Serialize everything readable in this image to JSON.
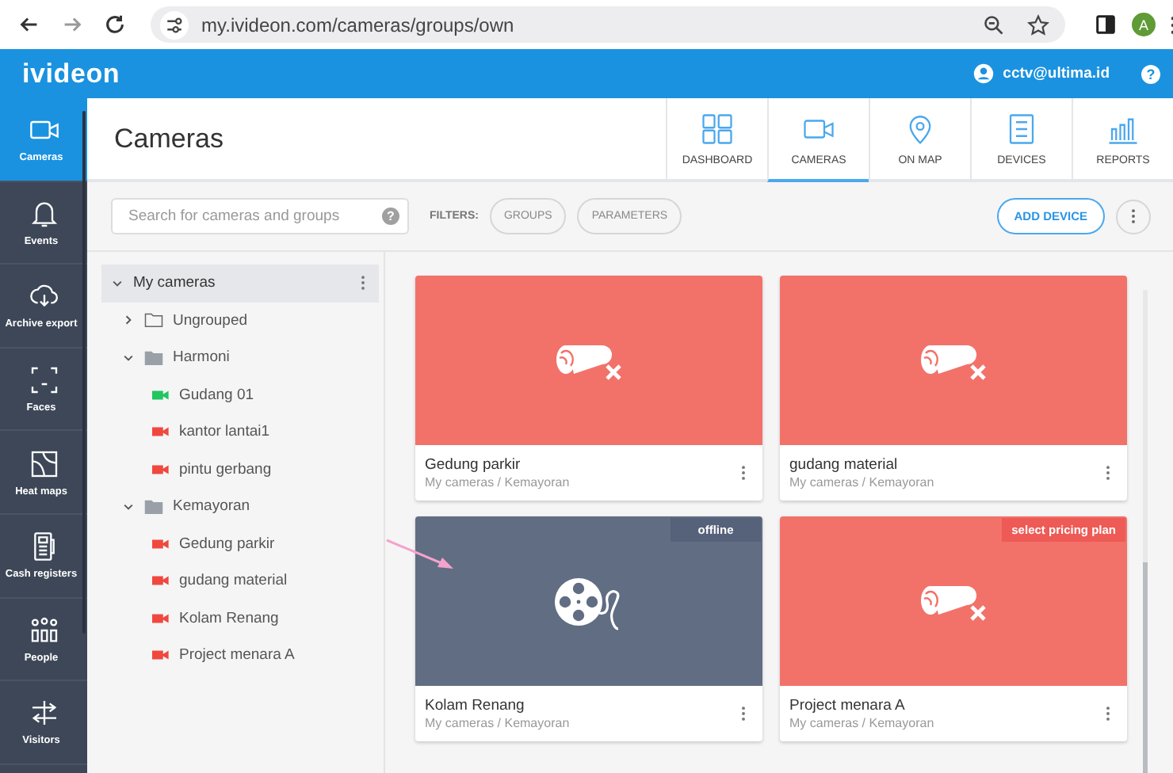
{
  "browser": {
    "url": "my.ivideon.com/cameras/groups/own",
    "profile": "A"
  },
  "app": {
    "logo": "ivideon",
    "account": "cctv@ultima.id",
    "help": "?"
  },
  "sidebar": {
    "items": [
      {
        "label": "Cameras",
        "selected": true
      },
      {
        "label": "Events",
        "selected": false
      },
      {
        "label": "Archive export",
        "selected": false
      },
      {
        "label": "Faces",
        "selected": false
      },
      {
        "label": "Heat maps",
        "selected": false
      },
      {
        "label": "Cash registers",
        "selected": false
      },
      {
        "label": "People",
        "selected": false
      },
      {
        "label": "Visitors",
        "selected": false
      }
    ]
  },
  "page": {
    "title": "Cameras"
  },
  "tabs": [
    {
      "label": "DASHBOARD",
      "selected": false
    },
    {
      "label": "CAMERAS",
      "selected": true
    },
    {
      "label": "ON MAP",
      "selected": false
    },
    {
      "label": "DEVICES",
      "selected": false
    },
    {
      "label": "REPORTS",
      "selected": false
    }
  ],
  "toolbar": {
    "search": {
      "placeholder": "Search for cameras and groups"
    },
    "help": "?",
    "filters_label": "FILTERS:",
    "filters": [
      "GROUPS",
      "PARAMETERS"
    ],
    "add_button": "ADD DEVICE"
  },
  "tree": {
    "label": "My cameras",
    "expanded": true,
    "selected": true,
    "children": [
      {
        "kind": "group",
        "label": "Ungrouped",
        "expanded": false
      },
      {
        "kind": "group",
        "label": "Harmoni",
        "expanded": true,
        "children": [
          {
            "kind": "camera",
            "label": "Gudang 01",
            "color": "#22c55e"
          },
          {
            "kind": "camera",
            "label": "kantor lantai1",
            "color": "#f0483e"
          },
          {
            "kind": "camera",
            "label": "pintu gerbang",
            "color": "#f0483e"
          }
        ]
      },
      {
        "kind": "group",
        "label": "Kemayoran",
        "expanded": true,
        "children": [
          {
            "kind": "camera",
            "label": "Gedung parkir",
            "color": "#f0483e"
          },
          {
            "kind": "camera",
            "label": "gudang material",
            "color": "#f0483e"
          },
          {
            "kind": "camera",
            "label": "Kolam Renang",
            "color": "#f0483e"
          },
          {
            "kind": "camera",
            "label": "Project menara A",
            "color": "#f0483e"
          }
        ]
      }
    ]
  },
  "cards": [
    {
      "kind": "unavailable",
      "name": "Gedung parkir",
      "path": "My cameras / Kemayoran"
    },
    {
      "kind": "unavailable",
      "name": "gudang material",
      "path": "My cameras / Kemayoran"
    },
    {
      "kind": "offline",
      "name": "Kolam Renang",
      "path": "My cameras / Kemayoran",
      "badge": "offline"
    },
    {
      "kind": "unavailable",
      "name": "Project menara A",
      "path": "My cameras / Kemayoran",
      "badge": "select pricing plan"
    }
  ]
}
